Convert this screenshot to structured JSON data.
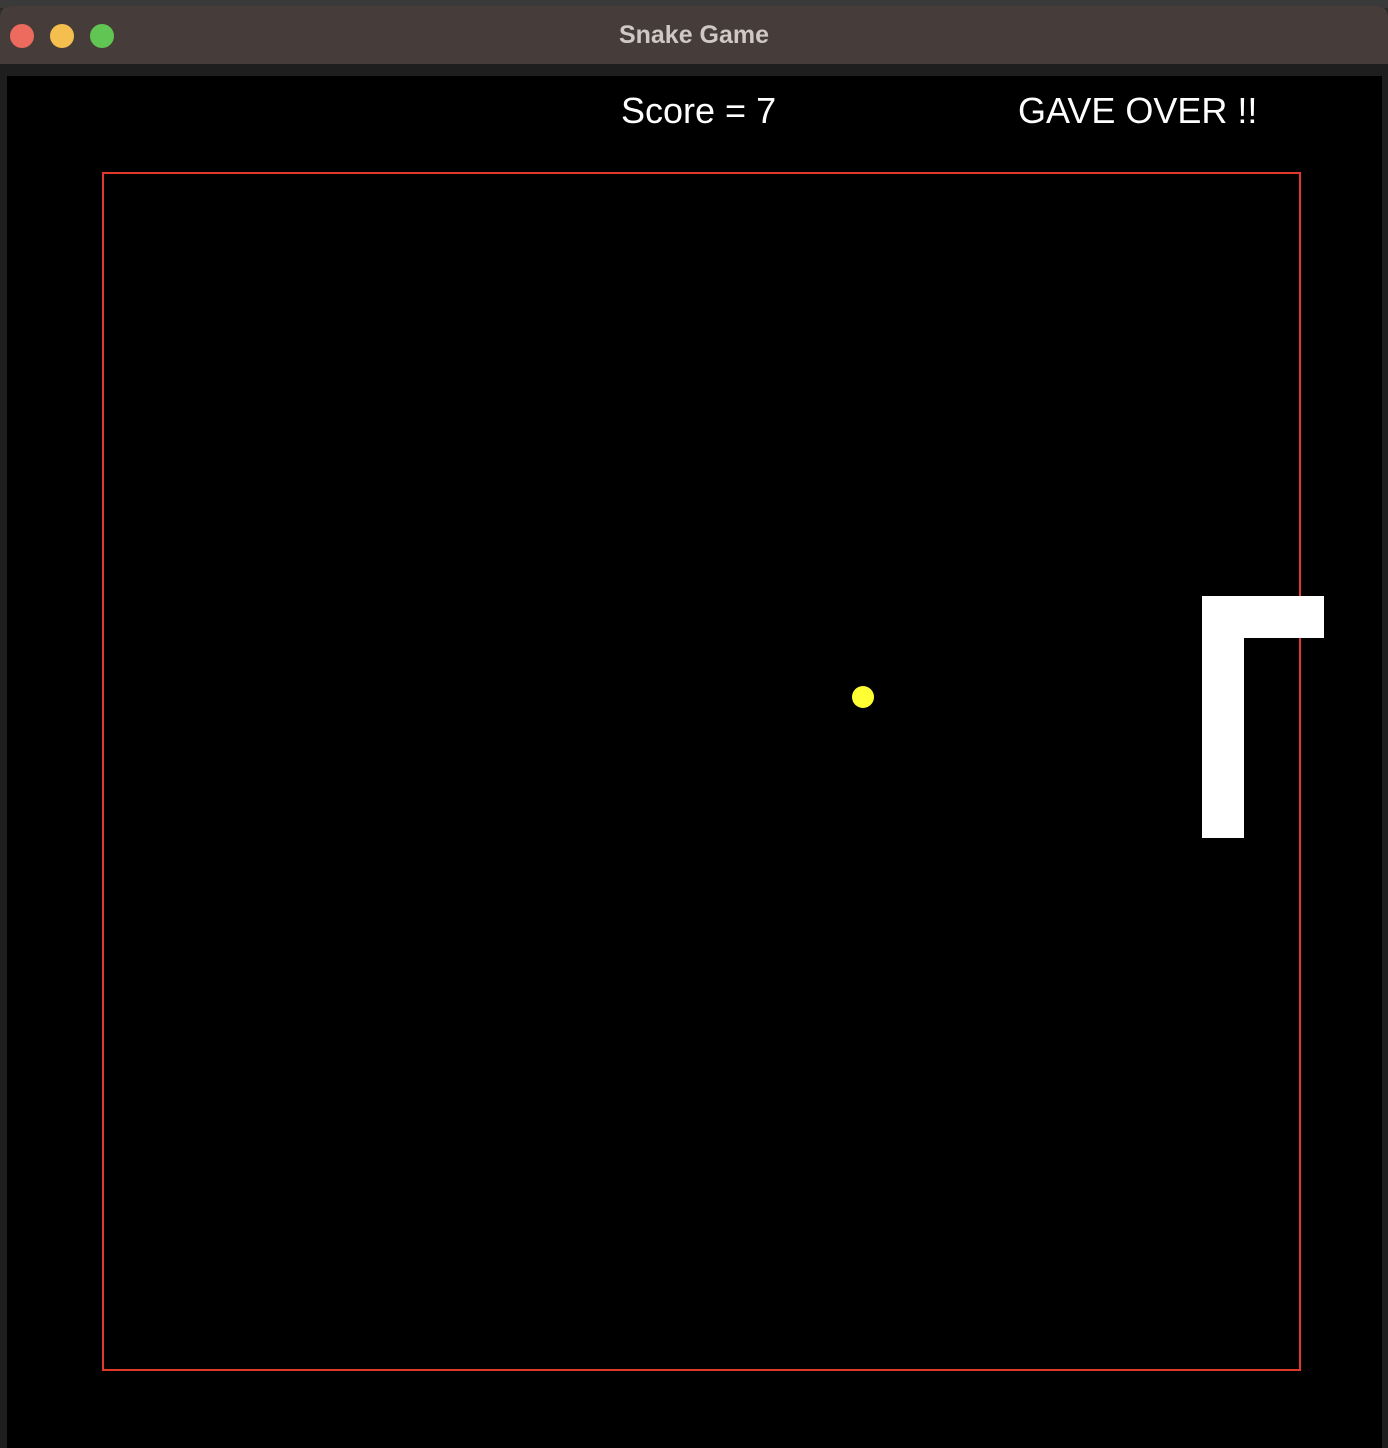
{
  "window": {
    "title": "Snake Game"
  },
  "hud": {
    "score_text": "Score = 7",
    "status_text": "GAVE OVER !!"
  },
  "game": {
    "score": 7,
    "state": "game-over",
    "colors": {
      "background": "#000000",
      "boundary": "#e0392b",
      "snake": "#ffffff",
      "food": "#ffff33",
      "text": "#ffffff"
    }
  }
}
